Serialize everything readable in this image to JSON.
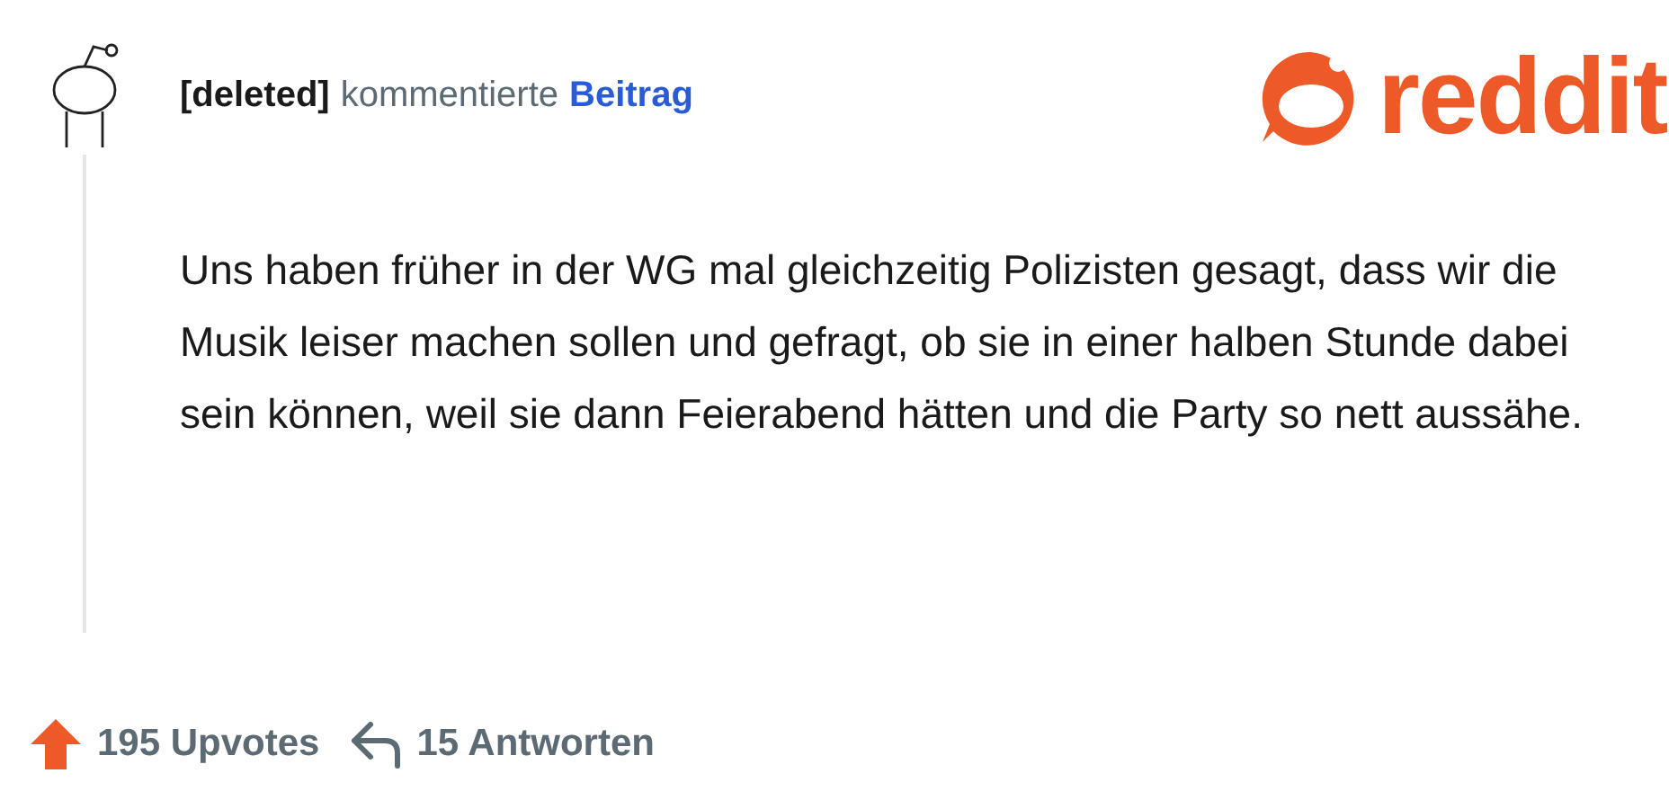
{
  "comment": {
    "author": "[deleted]",
    "action": "kommentierte",
    "target": "Beitrag",
    "body": "Uns haben früher in der WG mal gleichzeitig Polizisten gesagt, dass wir die Musik leiser machen sollen und gefragt, ob sie in einer halben Stunde dabei sein können, weil sie dann Feierabend hätten und die Party so nett aussähe."
  },
  "logo": {
    "wordmark": "reddit"
  },
  "footer": {
    "upvoted": true,
    "upvotes": "195 Upvotes",
    "replies": "15 Antworten"
  }
}
